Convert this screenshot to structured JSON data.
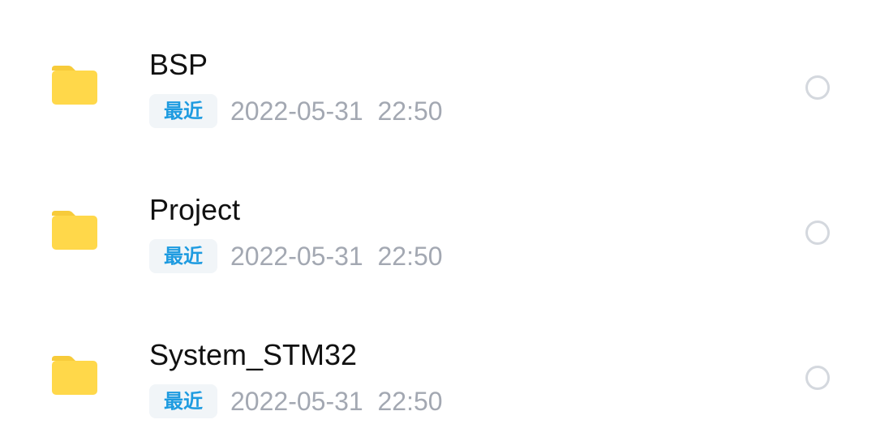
{
  "files": [
    {
      "name": "BSP",
      "badge": "最近",
      "modified": "2022-05-31  22:50",
      "icon": "folder-icon"
    },
    {
      "name": "Project",
      "badge": "最近",
      "modified": "2022-05-31  22:50",
      "icon": "folder-icon"
    },
    {
      "name": "System_STM32",
      "badge": "最近",
      "modified": "2022-05-31  22:50",
      "icon": "folder-icon"
    }
  ],
  "colors": {
    "folder": "#FFD84A",
    "folder_tab": "#F7CB3A",
    "badge_text": "#1E9BE0",
    "badge_bg": "#F1F5F8",
    "time_text": "#A3A8B2",
    "radio_border": "#D4D8DE"
  }
}
